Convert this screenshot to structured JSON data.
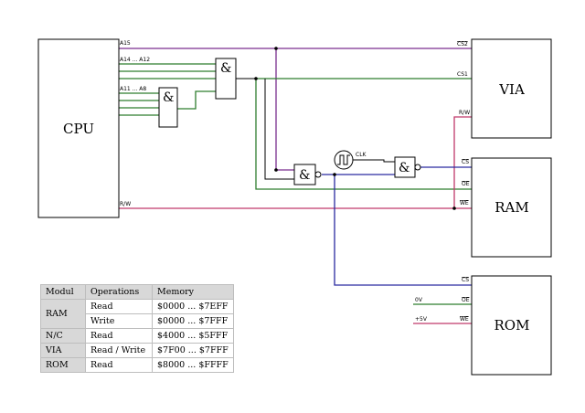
{
  "blocks": {
    "cpu": "CPU",
    "via": "VIA",
    "ram": "RAM",
    "rom": "ROM"
  },
  "gate_symbol": "&",
  "cpu_pins": {
    "a15": "A15",
    "a14_a12": "A14 ... A12",
    "a11_a8": "A11 ... A8",
    "rw": "R/W"
  },
  "via_pins": {
    "cs2": "CS2",
    "cs1": "CS1",
    "rw": "R/W"
  },
  "ram_pins": {
    "cs": "CS",
    "oe": "OE",
    "we": "WE"
  },
  "rom_pins": {
    "cs": "CS",
    "oe": "OE",
    "we": "WE"
  },
  "clock_label": "CLK",
  "rom_inputs": {
    "gnd": "0V",
    "vcc": "+5V"
  },
  "wire_colors": {
    "a15": "#7a2f8f",
    "address": "#2e7d2e",
    "rw": "#c0396b",
    "select": "#2a2aa0"
  },
  "table": {
    "headers": [
      "Modul",
      "Operations",
      "Memory"
    ],
    "rows": [
      {
        "module": "RAM",
        "operation": "Read",
        "memory": "$0000 ... $7EFF"
      },
      {
        "module": "",
        "operation": "Write",
        "memory": "$0000 ... $7FFF"
      },
      {
        "module": "N/C",
        "operation": "Read",
        "memory": "$4000 ... $5FFF"
      },
      {
        "module": "VIA",
        "operation": "Read / Write",
        "memory": "$7F00 ... $7FFF"
      },
      {
        "module": "ROM",
        "operation": "Read",
        "memory": "$8000 ... $FFFF"
      }
    ]
  }
}
